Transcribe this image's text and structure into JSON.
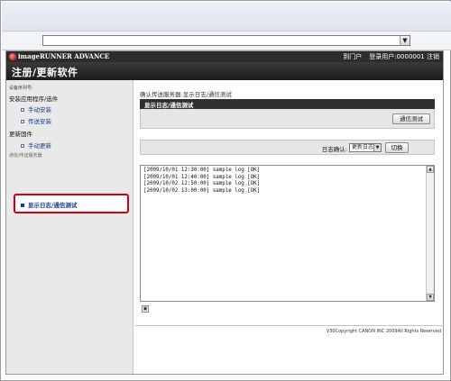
{
  "browser": {
    "url_value": ""
  },
  "brand": {
    "product_name": "imageRUNNER ADVANCE",
    "portal_link": "到门户",
    "login_user": "登录用户:0000001",
    "logout_link": "注销"
  },
  "page": {
    "title": "注册/更新软件"
  },
  "sidebar": {
    "dept_id": "设备序列号:",
    "groups": [
      {
        "header": "安装应用程序/选件",
        "items": [
          "手动安装",
          "传送安装"
        ]
      },
      {
        "header": "更新固件",
        "items": [
          "手动更新"
        ]
      }
    ],
    "truncated_text": "通信/传送服务器",
    "active_item": "显示日志/通信测试"
  },
  "main": {
    "breadcrumb": "确认传送服务器:显示日志/通信测试",
    "section_title": "显示日志/通信测试",
    "comm_test_button": "通信测试",
    "log_check_label": "日志确认:",
    "log_select_value": "更新日志",
    "switch_button": "切换",
    "log_lines": [
      "[2009/10/01 12:30:00] sample log [OK]",
      "[2009/10/01 12:40:00] sample log [OK]",
      "[2009/10/02 12:50:00] sample log [OK]",
      "[2009/10/02 13:00:00] sample log [OK]"
    ]
  },
  "footer": {
    "copyright": "V30Copyright CANON INC 2009All Rights Reserved"
  },
  "colors": {
    "highlight_border": "#d4000f",
    "header_dark": "#2f2f2f",
    "link_blue": "#1a3d8c"
  }
}
